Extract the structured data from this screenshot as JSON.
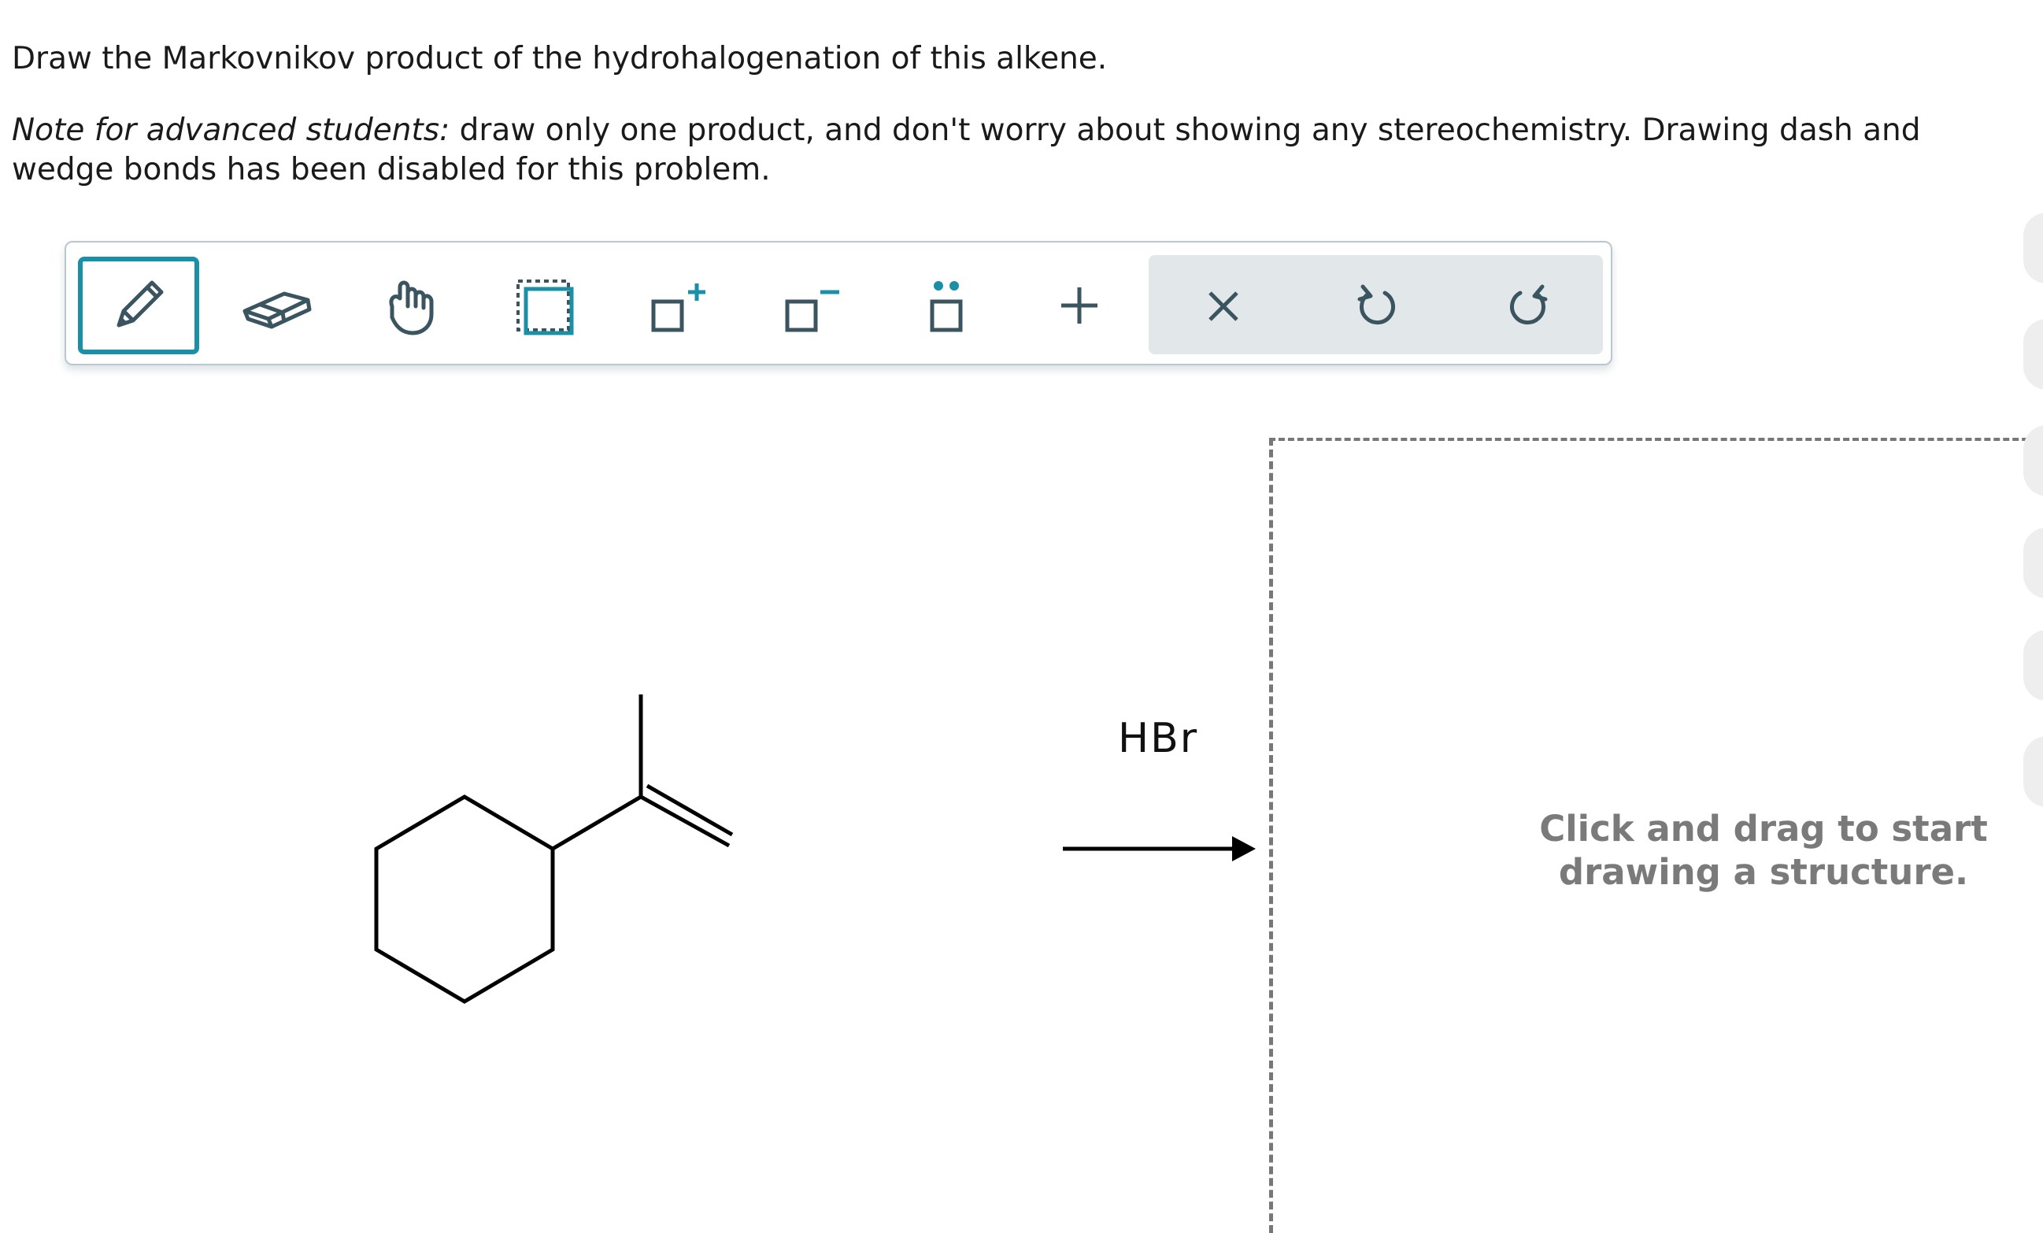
{
  "question": {
    "prompt": "Draw the Markovnikov product of the hydrohalogenation of this alkene.",
    "note_emphasis": "Note for advanced students:",
    "note_text": " draw only one product, and don't worry about showing any stereochemistry. Drawing dash and wedge bonds has been disabled for this problem."
  },
  "toolbar": {
    "tools": [
      {
        "name": "pencil-icon",
        "active": true
      },
      {
        "name": "eraser-icon"
      },
      {
        "name": "hand-icon"
      },
      {
        "name": "select-icon"
      },
      {
        "name": "positive-charge-icon"
      },
      {
        "name": "negative-charge-icon"
      },
      {
        "name": "lone-pair-icon"
      },
      {
        "name": "plus-icon"
      }
    ],
    "actions": [
      {
        "name": "close-icon"
      },
      {
        "name": "undo-icon"
      },
      {
        "name": "redo-icon"
      }
    ],
    "accent_color": "#1a8fa6"
  },
  "reaction": {
    "reagent": "HBr"
  },
  "canvas": {
    "hint": "Click and drag to start drawing a structure."
  }
}
